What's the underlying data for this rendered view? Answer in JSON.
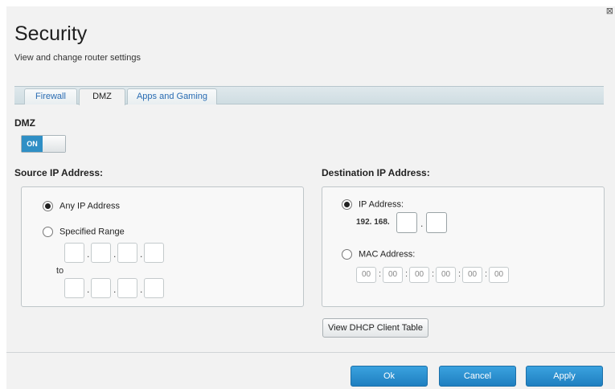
{
  "window": {
    "close_glyph": "⊠"
  },
  "header": {
    "title": "Security",
    "subtitle": "View and change router settings"
  },
  "tabs": [
    {
      "label": "Firewall",
      "active": false
    },
    {
      "label": "DMZ",
      "active": true
    },
    {
      "label": "Apps and Gaming",
      "active": false
    }
  ],
  "dmz": {
    "label": "DMZ",
    "toggle_text": "ON",
    "toggle_state": "on"
  },
  "source": {
    "heading": "Source IP Address:",
    "option_any": "Any IP Address",
    "option_range": "Specified Range",
    "selected": "Any IP Address",
    "to_label": "to",
    "dot": "."
  },
  "destination": {
    "heading": "Destination IP Address:",
    "option_ip": "IP Address:",
    "ip_prefix": "192. 168.",
    "dot": ".",
    "option_mac": "MAC Address:",
    "selected": "IP Address:",
    "mac_placeholder": "00",
    "colon": ":"
  },
  "buttons": {
    "dhcp": "View DHCP Client Table",
    "ok": "Ok",
    "cancel": "Cancel",
    "apply": "Apply"
  },
  "colors": {
    "accent": "#2f8fc5",
    "button_blue": "#1f7fc0",
    "tab_text": "#2a6cb3"
  }
}
